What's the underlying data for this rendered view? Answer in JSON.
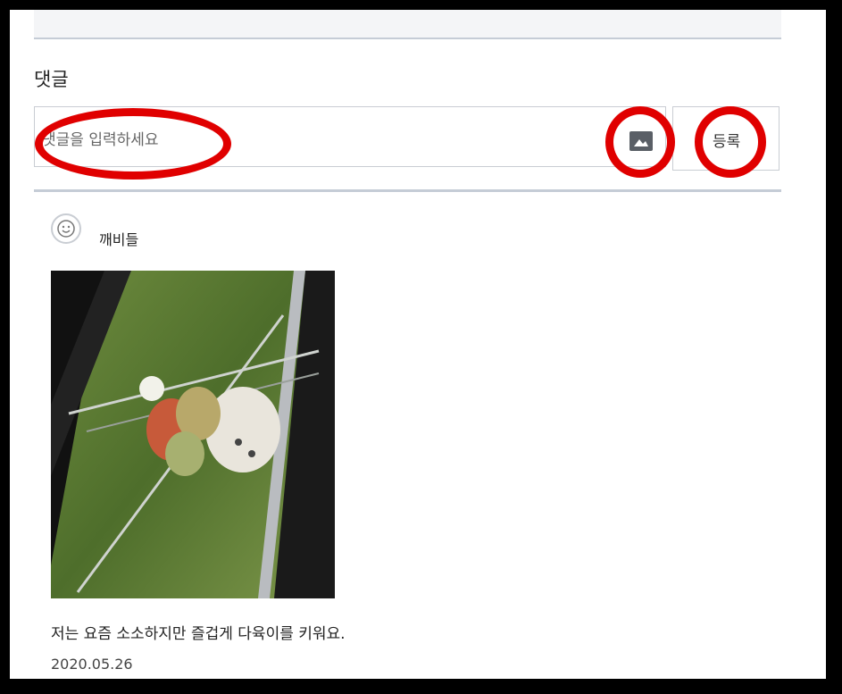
{
  "comments": {
    "title": "댓글",
    "input_placeholder": "댓글을 입력하세요",
    "image_icon": "image-icon",
    "submit_label": "등록"
  },
  "post": {
    "author": "깨비들",
    "avatar_icon": "smiley-icon",
    "text": "저는 요즘 소소하지만 즐겁게 다육이를 키워요.",
    "date": "2020.05.26"
  },
  "colors": {
    "highlight": "#e00000",
    "border": "#c9cdd3",
    "button_icon": "#5a5f66"
  }
}
